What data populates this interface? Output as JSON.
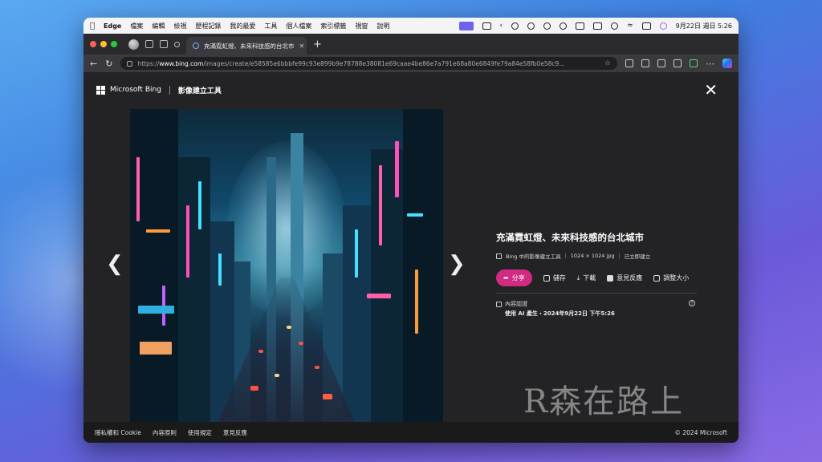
{
  "menubar": {
    "app_name": "Edge",
    "items": [
      "檔案",
      "編輯",
      "檢視",
      "歷程記錄",
      "我的最愛",
      "工具",
      "個人檔案",
      "索引標籤",
      "視窗",
      "說明"
    ],
    "datetime": "9月22日 週日 5:26"
  },
  "tab": {
    "title": "充滿霓虹燈、未來科技感的台北市"
  },
  "address": {
    "protocol": "https://",
    "host": "www.bing.com",
    "path": "/images/create/e58585e6bbbfe99c93e899b9e78788e38081e69caae4be86e7a791e68a80e6849fe79a84e58fb0e58c9..."
  },
  "header": {
    "brand": "Microsoft Bing",
    "tool_title": "影像建立工具"
  },
  "image_info": {
    "title": "充滿霓虹燈、未來科技感的台北城市",
    "source": "Bing 中的影像建立工具",
    "size": "1024 × 1024 jpg",
    "status": "已立即建立",
    "actions": {
      "share": "分享",
      "save": "儲存",
      "download": "下載",
      "feedback": "意見反應",
      "resize": "調整大小"
    },
    "credential_label": "內容認證",
    "credential_detail": "使用 AI 產生・2024年9月22日 下午5:26"
  },
  "watermark": "R森在路上",
  "footer": {
    "links": [
      "隱私權和 Cookie",
      "內容原則",
      "使用規定",
      "意見反應"
    ],
    "copyright": "© 2024 Microsoft"
  }
}
